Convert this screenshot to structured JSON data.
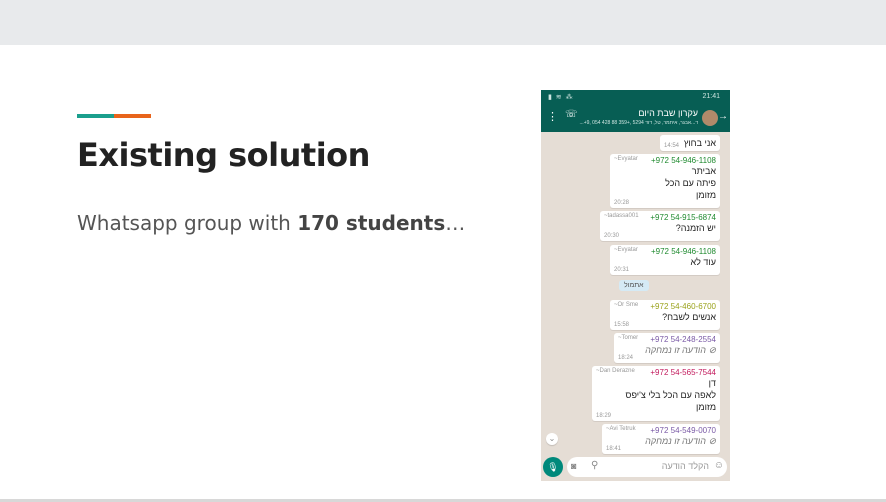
{
  "slide": {
    "title": "Existing solution",
    "body_prefix": "Whatsapp group with ",
    "body_bold": "170 students",
    "body_suffix": "…",
    "colors": {
      "accent_teal": "#1a9f8d",
      "accent_orange": "#e8641b"
    }
  },
  "phone": {
    "status_left": "",
    "status_time": "21:41",
    "header": {
      "group_name": "עקרון שבת היום",
      "members": "...+9, 054 428 88 359+, 5294 ד...אבגר, איתמר, טל, דוד"
    },
    "messages": [
      {
        "nick": "",
        "number": "",
        "number_color": "#1f8a2f",
        "lines": [
          "אני בחוץ"
        ],
        "time": "14:54",
        "deleted": false
      },
      {
        "nick": "~Evyatar",
        "number": "+972 54-946-1108",
        "number_color": "#1f8a2f",
        "lines": [
          "אביתר",
          "פיתה עם הכל",
          "מזומן"
        ],
        "time": "20:28",
        "deleted": false
      },
      {
        "nick": "~tadassa001",
        "number": "+972 54-915-6874",
        "number_color": "#1f8a2f",
        "lines": [
          "יש הזמנה?"
        ],
        "time": "20:30",
        "deleted": false
      },
      {
        "nick": "~Evyatar",
        "number": "+972 54-946-1108",
        "number_color": "#1f8a2f",
        "lines": [
          "עוד לא"
        ],
        "time": "20:31",
        "deleted": false
      },
      {
        "nick": "~Or Sme",
        "number": "+972 54-460-6700",
        "number_color": "#9aa21b",
        "lines": [
          "אנשים לשבח?"
        ],
        "time": "15:58",
        "deleted": false
      },
      {
        "nick": "~Tomer",
        "number": "+972 54-248-2554",
        "number_color": "#7a5aa6",
        "lines": [
          "⊘ הודעה זו נמחקה"
        ],
        "time": "18:24",
        "deleted": true
      },
      {
        "nick": "~Dan Derazne",
        "number": "+972 54-565-7544",
        "number_color": "#c2185b",
        "lines": [
          "דן",
          "לאפה עם הכל בלי צ'יפס",
          "מזומן"
        ],
        "time": "18:29",
        "deleted": false
      },
      {
        "nick": "~Avi Tetruk",
        "number": "+972 54-549-0070",
        "number_color": "#7a5aa6",
        "lines": [
          "⊘ הודעה זו נמחקה"
        ],
        "time": "18:41",
        "deleted": true
      }
    ],
    "system_pill": "אתמול",
    "input_placeholder": "הקלד הודעה",
    "icons": [
      "menu-dots-icon",
      "phone-call-icon",
      "back-arrow-icon",
      "scroll-down-icon",
      "mic-icon",
      "camera-icon",
      "attach-icon",
      "emoji-icon"
    ],
    "colors": {
      "header": "#075e54",
      "chat_bg": "#e5ddd5",
      "mic": "#00897b"
    }
  }
}
